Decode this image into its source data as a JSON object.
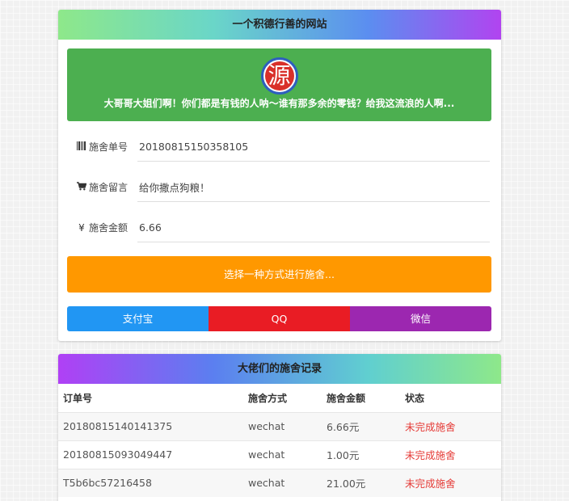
{
  "top_panel": {
    "title": "一个积德行善的网站",
    "banner": {
      "logo_char": "源",
      "message": "大哥哥大姐们啊！你们都是有钱的人呐～谁有那多余的零钱？给我这流浪的人啊..."
    },
    "form": {
      "order_no": {
        "label": "施舍单号",
        "icon": "barcode-icon",
        "value": "20180815150358105"
      },
      "message": {
        "label": "施舍留言",
        "icon": "cart-icon",
        "value": "给你撒点狗粮！"
      },
      "amount": {
        "label": "施舍金额",
        "icon": "yen-icon",
        "value": "6.66"
      }
    },
    "pay_prompt": "选择一种方式进行施舍...",
    "pay_buttons": {
      "alipay": "支付宝",
      "qq": "QQ",
      "wechat": "微信"
    }
  },
  "bottom_panel": {
    "title": "大佬们的施舍记录",
    "columns": [
      "订单号",
      "施舍方式",
      "施舍金额",
      "状态"
    ],
    "rows": [
      [
        "20180815140141375",
        "wechat",
        "6.66元",
        "未完成施舍"
      ],
      [
        "20180815093049447",
        "wechat",
        "1.00元",
        "未完成施舍"
      ],
      [
        "T5b6bc57216458",
        "wechat",
        "21.00元",
        "未完成施舍"
      ]
    ]
  },
  "colors": {
    "banner_green": "#4caf50",
    "prompt_orange": "#ff9800",
    "alipay_blue": "#2196f3",
    "qq_red": "#e91c24",
    "wechat_purple": "#9c27b0",
    "status_red": "#e53935"
  }
}
